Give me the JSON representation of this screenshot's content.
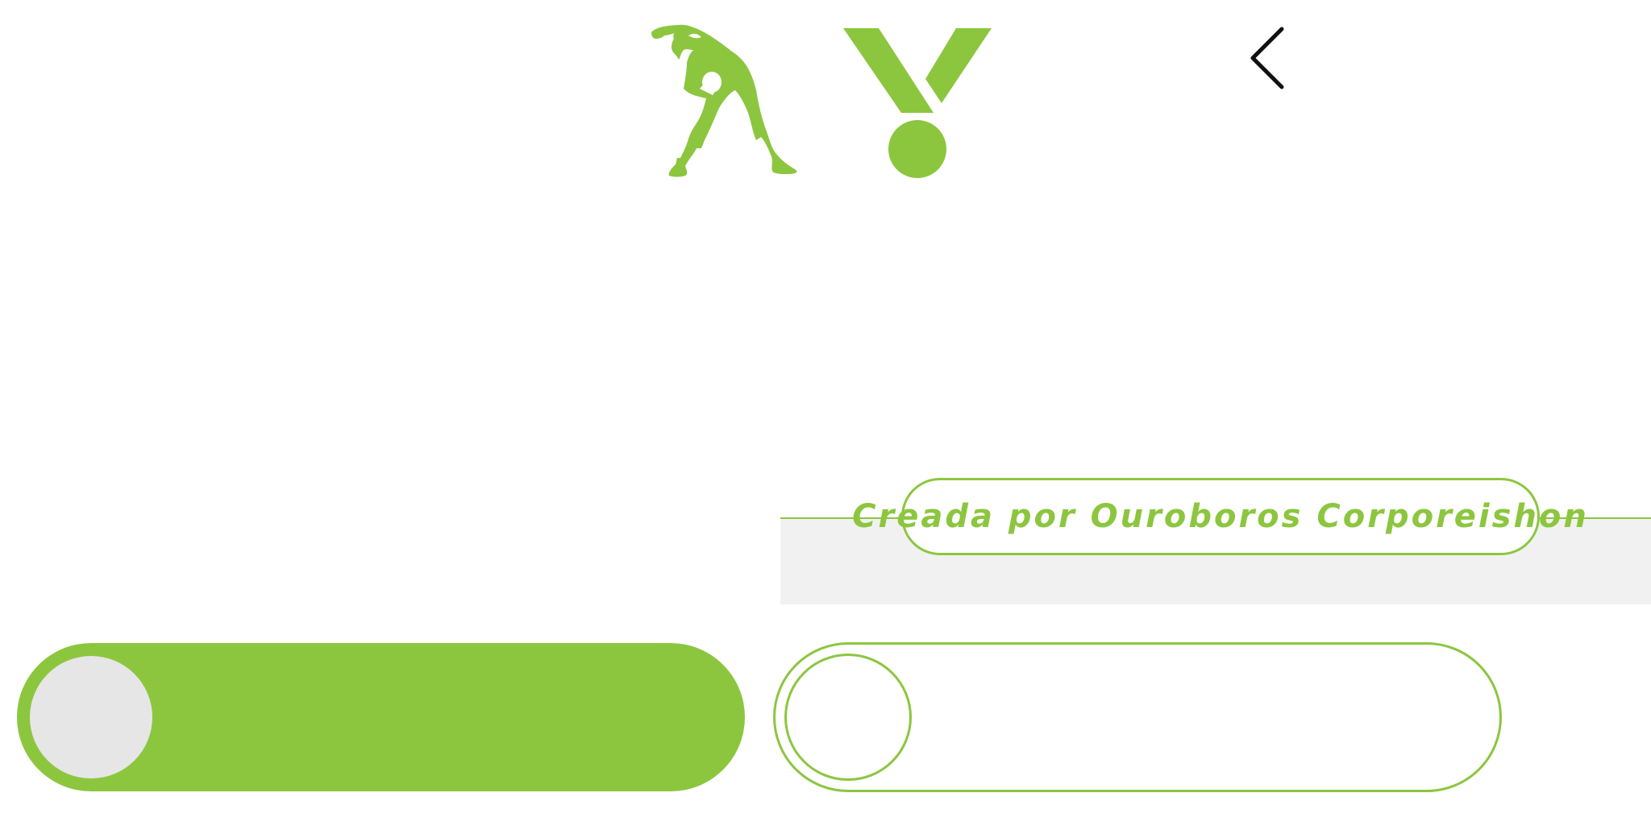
{
  "header": {
    "logo_icon": "stretching-person-icon",
    "brand_icon": "v-dot-logo-icon",
    "back_icon": "chevron-left-icon"
  },
  "credits": {
    "text": "Creada por Ouroboros Corporeishon"
  },
  "toggles": [
    {
      "name": "toggle-1",
      "state": "on"
    },
    {
      "name": "toggle-2",
      "state": "off"
    }
  ],
  "colors": {
    "accent": "#8cc63f",
    "knob_on": "#e6e6e6",
    "band": "#f1f1f1",
    "icon_dark": "#111111"
  }
}
